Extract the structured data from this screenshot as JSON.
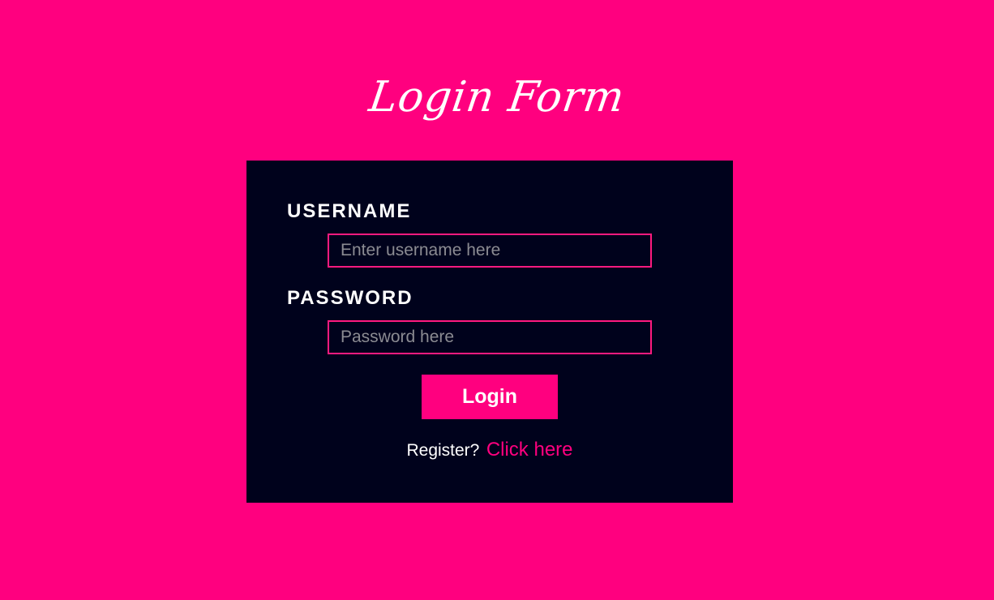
{
  "page": {
    "title": "Login Form",
    "background_color": "#ff007f"
  },
  "form": {
    "card_color": "#00021c",
    "username": {
      "label": "USERNAME",
      "placeholder": "Enter username here",
      "value": ""
    },
    "password": {
      "label": "PASSWORD",
      "placeholder": "Password here",
      "value": ""
    },
    "submit_label": "Login",
    "register": {
      "prompt": "Register?",
      "link_text": "Click here"
    },
    "accent_color": "#ff007f",
    "input_border_color": "#ff1a7f"
  }
}
